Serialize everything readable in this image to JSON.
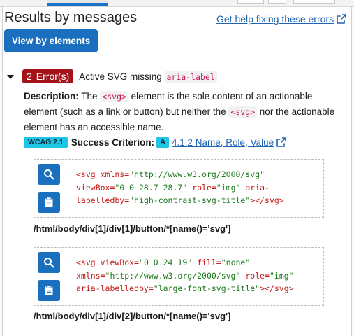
{
  "header": {
    "title": "Results by messages",
    "help_link": "Get help fixing these errors",
    "view_button": "View by elements"
  },
  "rule": {
    "count": "2",
    "count_label": "Error(s)",
    "name_prefix": "Active SVG missing ",
    "name_code": "aria-label",
    "description_label": "Description:",
    "desc_1": " The ",
    "desc_code_1": "<svg>",
    "desc_2": " element is the sole content of an actionable element (such as a link or button) but neither the ",
    "desc_code_2": "<svg>",
    "desc_3": " nor the actionable element has an accessible name.",
    "wcag_badge": "WCAG 2.1",
    "criterion_label": "Success Criterion:",
    "level": "A",
    "criterion_link": "4.1.2 Name, Role, Value"
  },
  "instances": [
    {
      "code": {
        "l1a": "<svg xmlns=",
        "l1v": "\"http://www.w3.org/2000/svg\"",
        "l2a": "viewBox=",
        "l2v": "\"0 0 28.7 28.7\"",
        "l2b": " role=",
        "l2w": "\"img\"",
        "l2c": " aria-",
        "l3a": "labelledby=",
        "l3v": "\"high-contrast-svg-title\"",
        "l3b": "></svg>"
      },
      "xpath": "/html/body/div[1]/div[1]/button/*[name()='svg']"
    },
    {
      "code": {
        "l1a": "<svg viewBox=",
        "l1v": "\"0 0 24 19\"",
        "l1b": " fill=",
        "l1w": "\"none\"",
        "l2a": "xmlns=",
        "l2v": "\"http://www.w3.org/2000/svg\"",
        "l2b": " role=",
        "l2w": "\"img\"",
        "l3a": "aria-labelledby=",
        "l3v": "\"large-font-svg-title\"",
        "l3b": "></svg>"
      },
      "xpath": "/html/body/div[1]/div[2]/button/*[name()='svg']"
    }
  ],
  "icons": {
    "inspect": "search-icon",
    "copy": "clipboard-icon",
    "external": "external-link-icon",
    "expand": "caret-down-icon"
  },
  "colors": {
    "primary": "#1a6fbe",
    "error": "#a4131a",
    "wcag": "#1ec6e6",
    "link": "#1f63b5"
  }
}
